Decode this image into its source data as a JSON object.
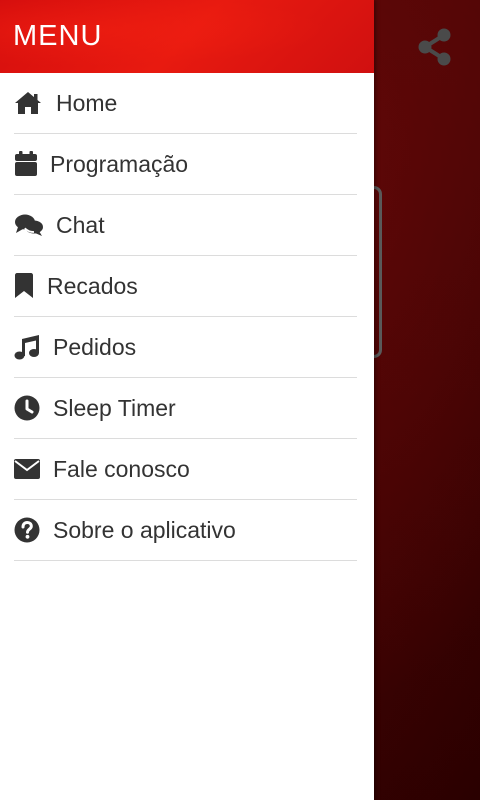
{
  "drawer": {
    "title": "MENU",
    "items": [
      {
        "label": "Home",
        "icon": "home-icon"
      },
      {
        "label": "Programação",
        "icon": "calendar-icon"
      },
      {
        "label": "Chat",
        "icon": "chat-icon"
      },
      {
        "label": "Recados",
        "icon": "bookmark-icon"
      },
      {
        "label": "Pedidos",
        "icon": "music-icon"
      },
      {
        "label": "Sleep Timer",
        "icon": "clock-icon"
      },
      {
        "label": "Fale conosco",
        "icon": "envelope-icon"
      },
      {
        "label": "Sobre o aplicativo",
        "icon": "question-circle-icon"
      }
    ]
  },
  "background_app": {
    "share_icon": "share-icon"
  },
  "colors": {
    "header_red": "#e3120b",
    "background_dark_red": "#3a0303",
    "text": "#333333",
    "divider": "#dcdcdc"
  }
}
